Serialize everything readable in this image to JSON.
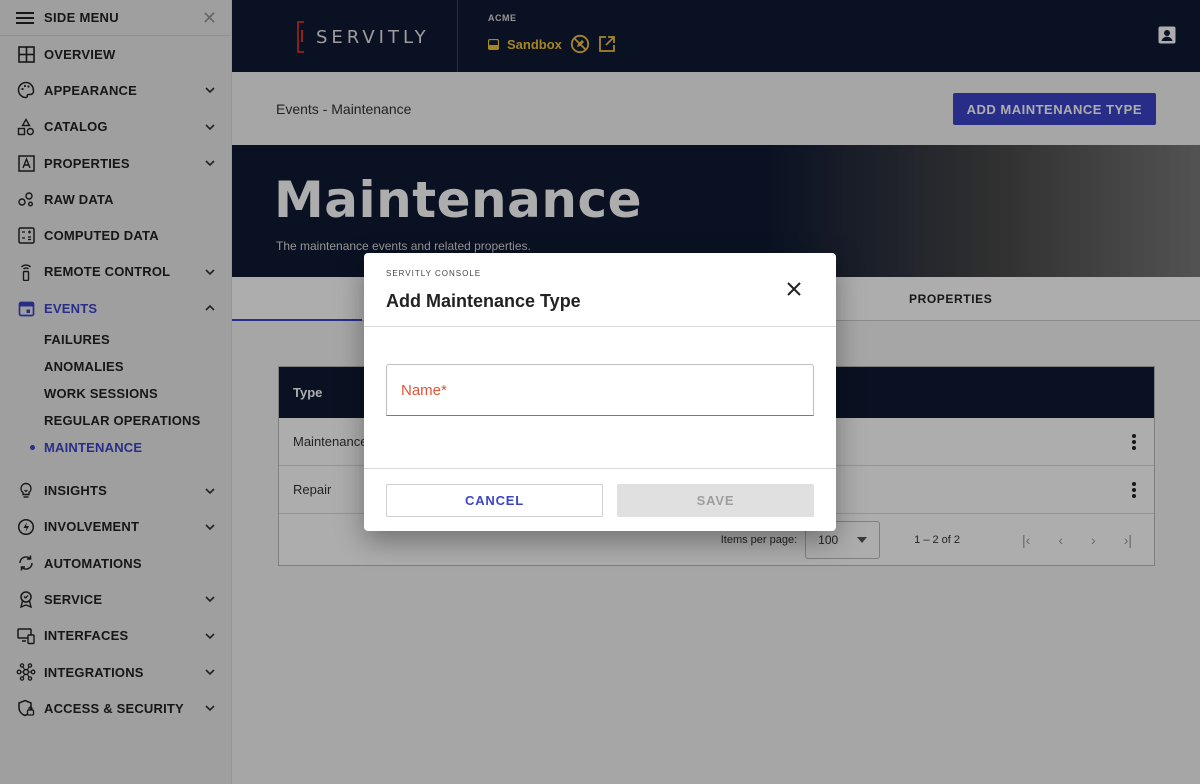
{
  "sidebar": {
    "title": "SIDE MENU",
    "items": [
      {
        "label": "OVERVIEW",
        "icon": "grid-icon"
      },
      {
        "label": "APPEARANCE",
        "icon": "palette-icon"
      },
      {
        "label": "CATALOG",
        "icon": "shapes-icon"
      },
      {
        "label": "PROPERTIES",
        "icon": "letter-a-box-icon"
      },
      {
        "label": "RAW DATA",
        "icon": "scatter-icon"
      },
      {
        "label": "COMPUTED DATA",
        "icon": "calculator-icon"
      },
      {
        "label": "REMOTE CONTROL",
        "icon": "remote-icon"
      },
      {
        "label": "EVENTS",
        "icon": "calendar-icon"
      },
      {
        "label": "INSIGHTS",
        "icon": "lightbulb-icon"
      },
      {
        "label": "INVOLVEMENT",
        "icon": "bolt-circle-icon"
      },
      {
        "label": "AUTOMATIONS",
        "icon": "refresh-icon"
      },
      {
        "label": "SERVICE",
        "icon": "badge-icon"
      },
      {
        "label": "INTERFACES",
        "icon": "devices-icon"
      },
      {
        "label": "INTEGRATIONS",
        "icon": "hub-icon"
      },
      {
        "label": "ACCESS & SECURITY",
        "icon": "shield-lock-icon"
      }
    ],
    "events_sub": [
      "FAILURES",
      "ANOMALIES",
      "WORK SESSIONS",
      "REGULAR OPERATIONS",
      "MAINTENANCE"
    ]
  },
  "topbar": {
    "logo_text": "SERVITLY",
    "org": "ACME",
    "environment": "Sandbox"
  },
  "page": {
    "breadcrumb": "Events - Maintenance",
    "add_button": "ADD MAINTENANCE TYPE",
    "title": "Maintenance",
    "subtitle": "The maintenance events and related properties.",
    "tab_properties": "PROPERTIES"
  },
  "table": {
    "header_type": "Type",
    "rows": [
      "Maintenance",
      "Repair"
    ],
    "items_per_page_label": "Items per page:",
    "items_per_page": "100",
    "range": "1 – 2 of 2"
  },
  "dialog": {
    "eyebrow": "SERVITLY CONSOLE",
    "title": "Add Maintenance Type",
    "name_placeholder": "Name*",
    "cancel": "CANCEL",
    "save": "SAVE"
  },
  "colors": {
    "accent": "#3b45c9",
    "navy": "#0f1a33",
    "env": "#f3c43a",
    "error": "#e25335"
  }
}
